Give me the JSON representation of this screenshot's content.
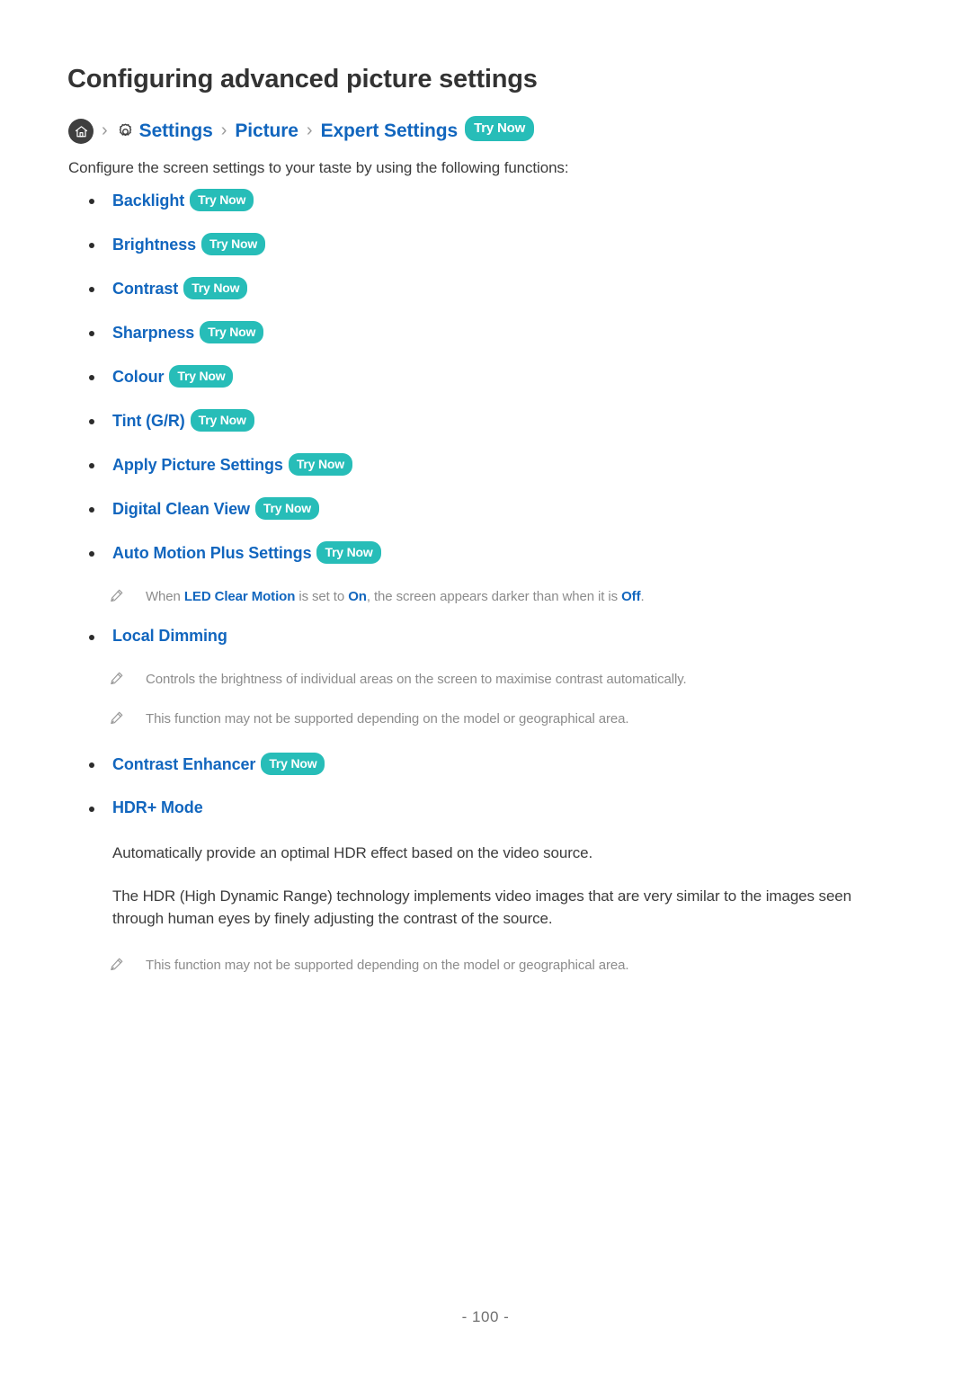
{
  "document": {
    "title": "Configuring advanced picture settings",
    "page_number": "- 100 -"
  },
  "breadcrumb": {
    "home_icon": "home-icon",
    "separator": "›",
    "gear_icon": "gear-icon",
    "items": [
      {
        "label": "Settings",
        "icon": "gear-icon"
      },
      {
        "label": "Picture",
        "icon": ""
      },
      {
        "label": "Expert Settings",
        "icon": ""
      }
    ],
    "try_now": "Try Now"
  },
  "intro": "Configure the screen settings to your taste by using the following functions:",
  "try_now_label": "Try Now",
  "list": [
    {
      "label": "Backlight",
      "try_now": "Try Now"
    },
    {
      "label": "Brightness",
      "try_now": "Try Now"
    },
    {
      "label": "Contrast",
      "try_now": "Try Now"
    },
    {
      "label": "Sharpness",
      "try_now": "Try Now"
    },
    {
      "label": "Colour",
      "try_now": "Try Now"
    },
    {
      "label": "Tint (G/R)",
      "try_now": "Try Now"
    },
    {
      "label": "Apply Picture Settings",
      "try_now": "Try Now"
    },
    {
      "label": "Digital Clean View",
      "try_now": "Try Now"
    },
    {
      "label": "Auto Motion Plus Settings",
      "try_now": "Try Now"
    }
  ],
  "notes": {
    "led_clear_motion": {
      "part1": "When ",
      "term1": "LED Clear Motion",
      "part2": " is set to ",
      "term2": "On",
      "part3": ", the screen appears darker than when it is ",
      "term3": "Off",
      "part4": "."
    },
    "local_dimming_1": "Controls the brightness of individual areas on the screen to maximise contrast automatically.",
    "local_dimming_2": "This function may not be supported depending on the model or geographical area.",
    "hdr_plus": "This function may not be supported depending on the model or geographical area."
  },
  "sections": {
    "local_dimming": {
      "label": "Local Dimming"
    },
    "contrast_enhancer": {
      "label": "Contrast Enhancer",
      "try_now": "Try Now"
    },
    "hdr_plus_mode": {
      "label": "HDR+ Mode",
      "paragraph_1": "Automatically provide an optimal HDR effect based on the video source.",
      "paragraph_2": "The HDR (High Dynamic Range) technology implements video images that are very similar to the images seen through human eyes by finely adjusting the contrast of the source."
    }
  },
  "colors": {
    "link_blue": "#1266be",
    "badge_teal": "#27bdb8",
    "body_text": "#3c3c3c",
    "note_gray": "#8c8c8c",
    "title": "#333333"
  }
}
